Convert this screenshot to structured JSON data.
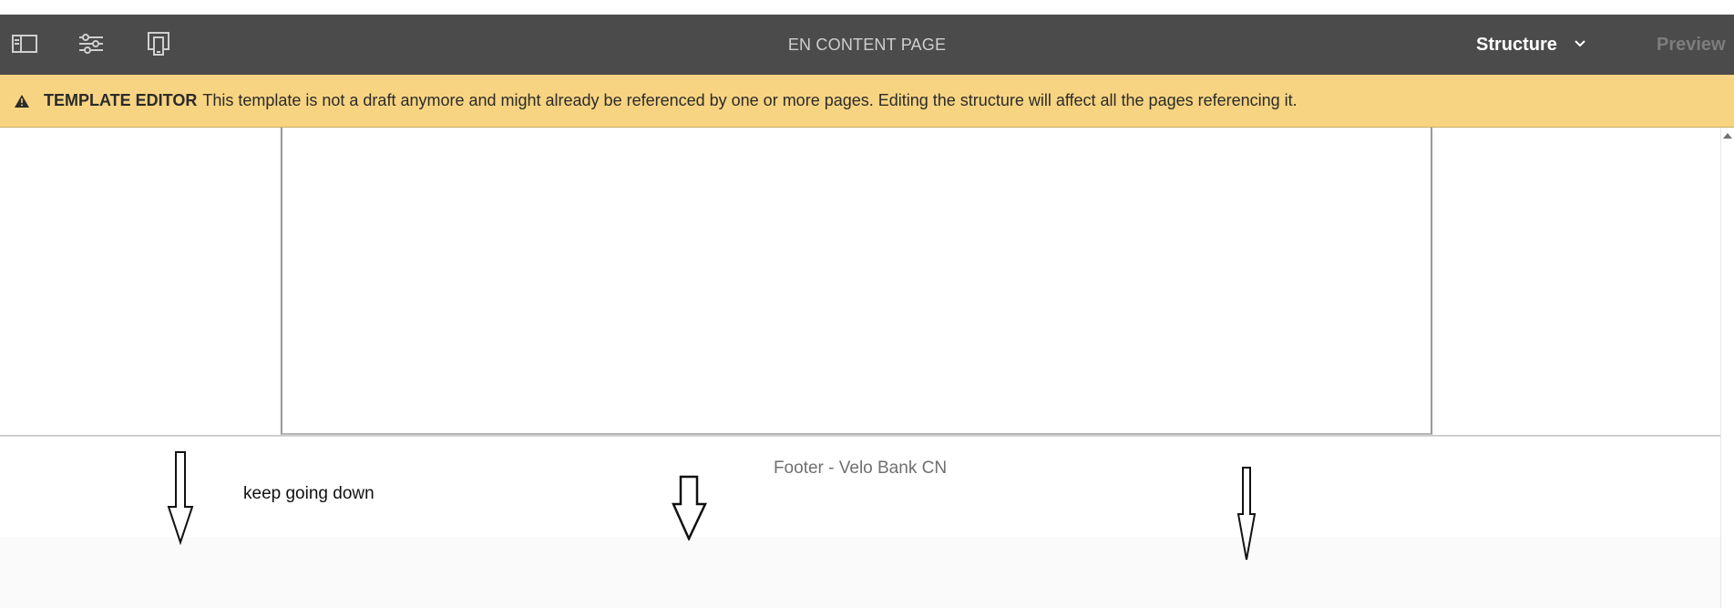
{
  "toolbar": {
    "title": "EN CONTENT PAGE",
    "mode_label": "Structure",
    "preview_label": "Preview",
    "icons": [
      "side-panel-toggle-icon",
      "page-properties-icon",
      "emulator-icon"
    ],
    "background": "#4b4b4b"
  },
  "warning": {
    "label": "TEMPLATE EDITOR",
    "message": "This template is not a draft anymore and might already be referenced by one or more pages. Editing the structure will affect all the pages referencing it.",
    "background": "#f7d481"
  },
  "footer": {
    "label": "Footer - Velo Bank CN"
  },
  "annotation": {
    "text": "keep going down"
  }
}
